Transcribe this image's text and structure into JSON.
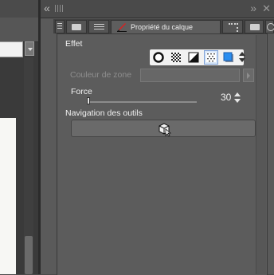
{
  "panel": {
    "tab_active_label": "Propriété du calque"
  },
  "effet": {
    "title": "Effet"
  },
  "zone": {
    "label": "Couleur de zone"
  },
  "force": {
    "label": "Force",
    "value": "30"
  },
  "navigation": {
    "title": "Navigation des outils"
  },
  "icons": {
    "panel_collapse": "double-chevron-left",
    "panel_expand": "double-chevron-right",
    "panel_close": "close",
    "effects": [
      "circle-outline",
      "checker-pattern",
      "diagonal-split",
      "tone-dots",
      "layer-color"
    ],
    "navigation": "cube-cursor"
  },
  "colors": {
    "accent_selected": "#7ea1d8",
    "panel_bg": "#5c5c5c"
  }
}
